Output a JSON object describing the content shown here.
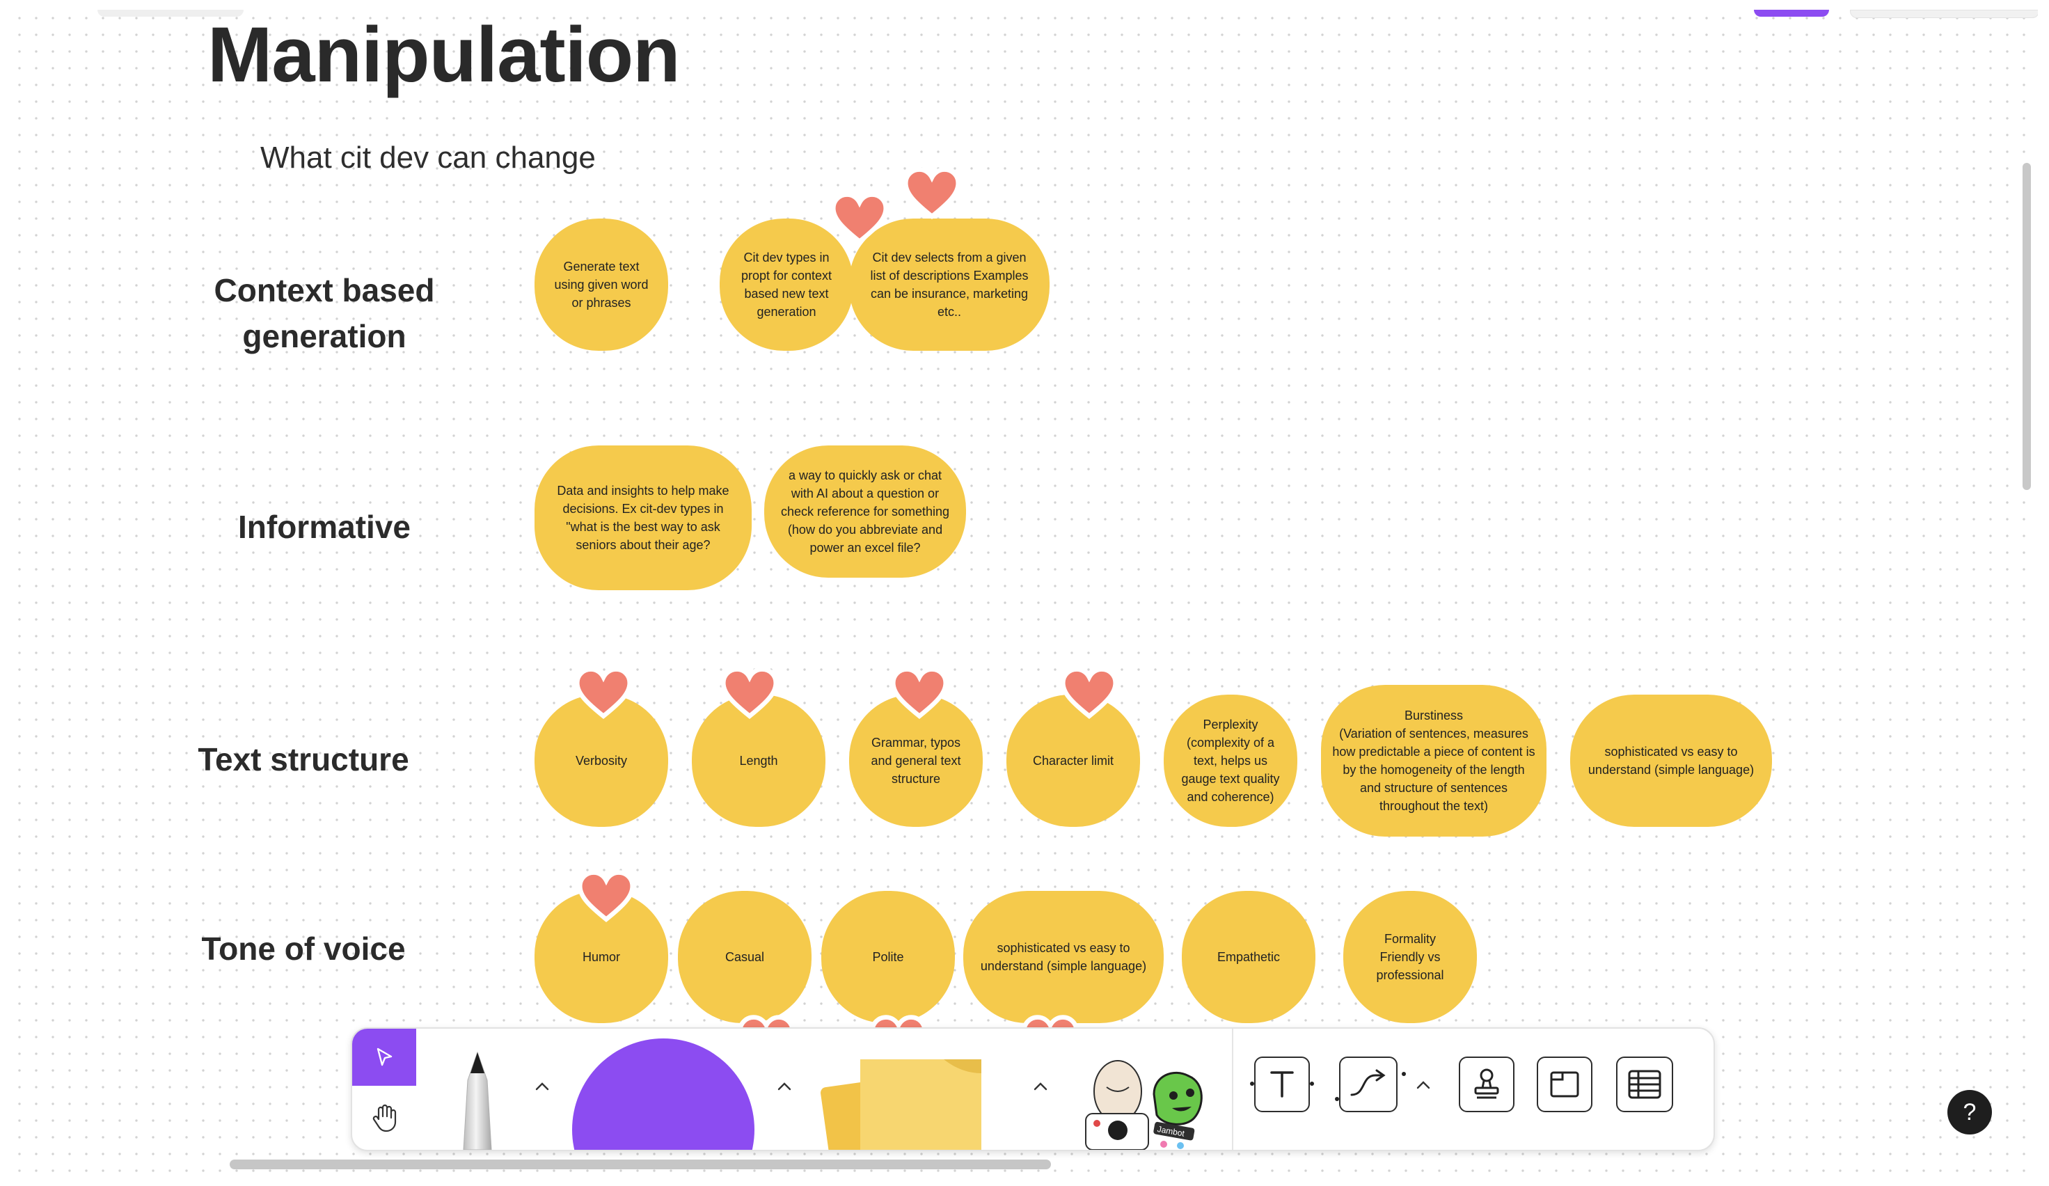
{
  "app": {
    "accent": "#8c4cf1",
    "sticky_color": "#f5ca4c",
    "heart_color": "#f08070"
  },
  "board": {
    "title": "Manipulation",
    "subtitle": "What cit dev can change"
  },
  "rows": [
    {
      "label": "Context based generation"
    },
    {
      "label": "Informative"
    },
    {
      "label": "Text structure"
    },
    {
      "label": "Tone of voice"
    }
  ],
  "stickies": {
    "context": [
      "Generate text using given word or phrases",
      "Cit dev types in propt for context based new text generation",
      "Cit dev selects from a given list of descriptions Examples can be insurance, marketing etc.."
    ],
    "informative": [
      "Data and insights to help make decisions. Ex cit-dev types in \"what is the best way to ask seniors about their age?",
      "a way to quickly ask or chat with AI about a question or check reference for something (how do you abbreviate and power an excel file?"
    ],
    "structure": [
      "Verbosity",
      "Length",
      "Grammar, typos and general text structure",
      "Character limit",
      "Perplexity (complexity of a text, helps us gauge text quality and coherence)",
      "Burstiness\n(Variation of sentences, measures how predictable a piece of content is by the homogeneity of the length and structure of sentences throughout the text)",
      "sophisticated vs easy to understand (simple language)"
    ],
    "tone": [
      "Humor",
      "Casual",
      "Polite",
      "sophisticated vs easy to understand (simple language)",
      "Empathetic",
      "Formality\nFriendly vs professional"
    ]
  },
  "toolbar": {
    "tools": [
      "select-tool",
      "hand-tool",
      "pen-tool",
      "shape-tool",
      "sticky-note-tool",
      "sticker-tool",
      "text-tool",
      "connector-tool",
      "stamp-tool",
      "section-tool",
      "table-tool"
    ],
    "sticker_label": "Jambot"
  },
  "help": {
    "label": "?"
  }
}
